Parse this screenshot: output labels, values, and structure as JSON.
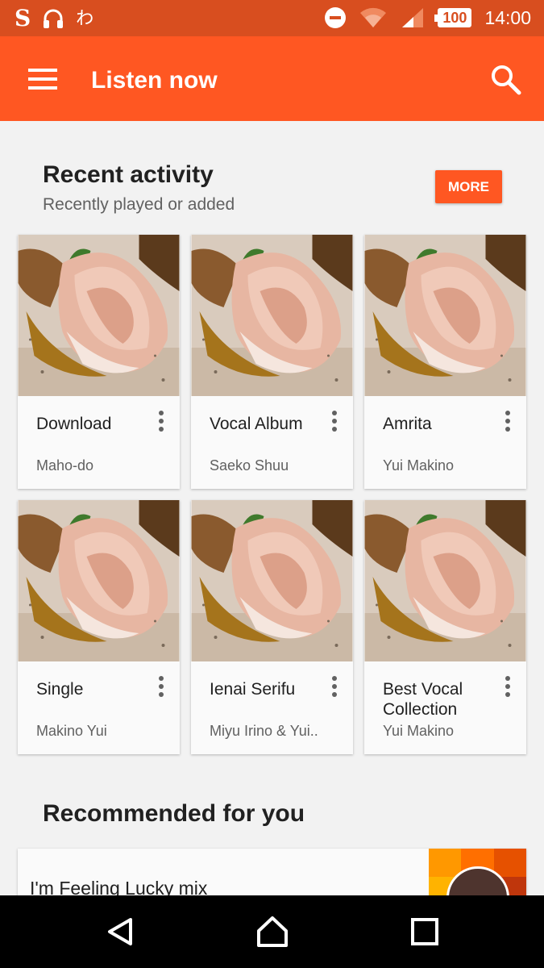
{
  "status_bar": {
    "time": "14:00",
    "battery": "100",
    "left_glyphs": {
      "s": "S",
      "wa": "わ"
    },
    "icons": [
      "s-notification-icon",
      "headphones-icon",
      "wa-notification-icon",
      "do-not-disturb-icon",
      "wifi-icon",
      "cell-signal-icon",
      "battery-icon"
    ]
  },
  "app_bar": {
    "title": "Listen now",
    "menu_icon": "hamburger-menu-icon",
    "search_icon": "search-icon",
    "color": "#ff5722"
  },
  "recent": {
    "title": "Recent activity",
    "subtitle": "Recently played or added",
    "more_label": "MORE",
    "cards": [
      {
        "title": "Download",
        "subtitle": "Maho-do"
      },
      {
        "title": "Vocal Album",
        "subtitle": "Saeko Shuu"
      },
      {
        "title": "Amrita",
        "subtitle": "Yui Makino"
      },
      {
        "title": "Single",
        "subtitle": "Makino Yui"
      },
      {
        "title": "Ienai Serifu",
        "subtitle": "Miyu Irino & Yui.."
      },
      {
        "title": "Best Vocal Collection",
        "subtitle": "Yui Makino"
      }
    ]
  },
  "recommended": {
    "title": "Recommended for you",
    "cards": [
      {
        "title": "I'm Feeling Lucky mix"
      }
    ]
  },
  "nav_bar": {
    "buttons": [
      "back-icon",
      "home-icon",
      "recents-icon"
    ]
  },
  "colors": {
    "accent": "#ff5722",
    "status_bar": "#d84e1f",
    "background": "#f2f2f2"
  }
}
